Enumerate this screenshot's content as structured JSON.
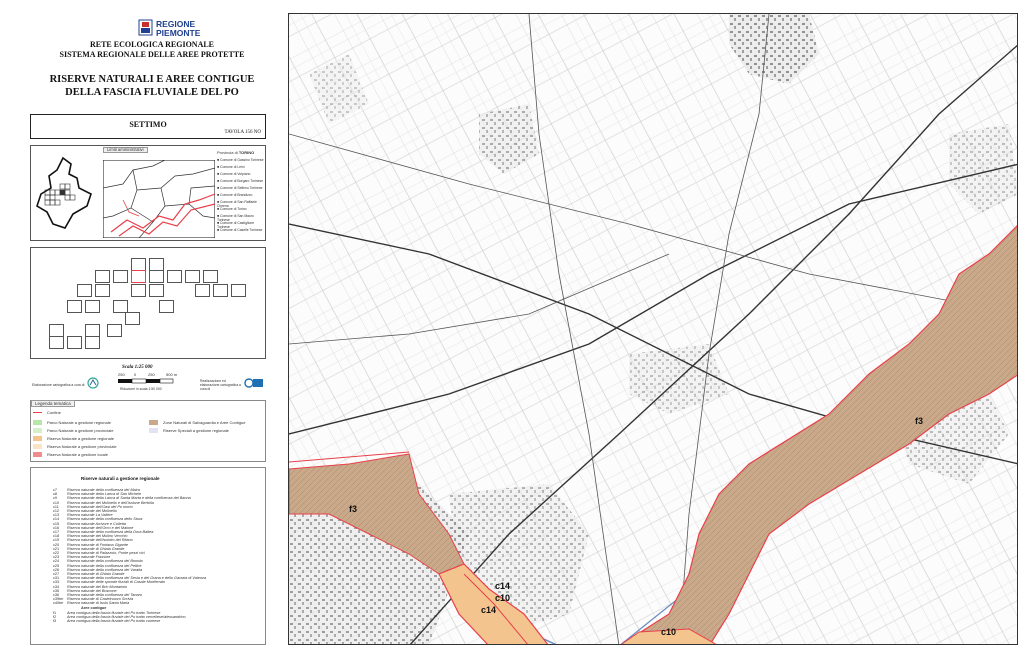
{
  "header": {
    "logo_line1": "REGIONE",
    "logo_line2": "PIEMONTE",
    "network_line1": "RETE ECOLOGICA REGIONALE",
    "network_line2": "SISTEMA REGIONALE DELLE AREE PROTETTE",
    "title_line1": "RISERVE NATURALI E AREE CONTIGUE",
    "title_line2": "DELLA FASCIA FLUVIALE DEL PO"
  },
  "sheet": {
    "name": "SETTIMO",
    "tavola": "TAVOLA 156 NO"
  },
  "admin": {
    "title": "Limiti amministrativi",
    "province_label": "Provincia di",
    "province_name": "TORINO",
    "communes": [
      "Comune di Gassino Torinese",
      "Comune di Leini",
      "Comune di Volpiano",
      "Comune di Borgaro Torinese",
      "Comune di Settimo Torinese",
      "Comune di Brandizzo",
      "Comune di San Raffaele Cimena",
      "Comune di Torino",
      "Comune di San Mauro Torinese",
      "Comune di Castiglione Torinese",
      "Comune di Caselle Torinese"
    ]
  },
  "scale": {
    "title": "Scala 1:25 000",
    "ticks": [
      "250",
      "0",
      "250",
      "500 m"
    ],
    "credit_left": "Elaborazione cartografica a cura di",
    "note": "Riduzione in scala 1:50 000",
    "credit_right": "Realizzazione ed elaborazione cartografica a cura di"
  },
  "legend": {
    "title": "Legenda tematica",
    "items": [
      {
        "label": "Confine",
        "color": "#e8404a"
      },
      {
        "label": "Parco Naturale a gestione regionale",
        "color": "#b7e6a9"
      },
      {
        "label": "Parco Naturale a gestione provinciale",
        "color": "#d5efc9"
      },
      {
        "label": "Riserva Naturale a gestione regionale",
        "color": "#f4c48f"
      },
      {
        "label": "Riserva Naturale a gestione provinciale",
        "color": "#fae4c6"
      },
      {
        "label": "Riserva Naturale a gestione locale",
        "color": "#ef8d8d"
      },
      {
        "label": "Zone Naturali di Salvaguardia e Aree Contigue",
        "color": "#c9a98a"
      },
      {
        "label": "Riserve Speciali a gestione regionale",
        "color": "#e3e3f4"
      }
    ]
  },
  "reserves": {
    "title": "Riserve naturali a gestione regionale",
    "items": [
      {
        "code": "c7",
        "name": "Riserva naturale della confluenza del Maira"
      },
      {
        "code": "c8",
        "name": "Riserva naturale della Lanca di San Michele"
      },
      {
        "code": "c9",
        "name": "Riserva naturale della Lanca di Santa Marta e della confluenza del Banna"
      },
      {
        "code": "c10",
        "name": "Riserva naturale del Molinello e dell'Isolone Bertolla"
      },
      {
        "code": "c11",
        "name": "Riserva naturale dell'Oasi del Po morto"
      },
      {
        "code": "c12",
        "name": "Riserva naturale del Molinello"
      },
      {
        "code": "c13",
        "name": "Riserva naturale La Vallere"
      },
      {
        "code": "c14",
        "name": "Riserva naturale della confluenza dello Stura"
      },
      {
        "code": "c15",
        "name": "Riserva naturale Arrivore e Colletta"
      },
      {
        "code": "c16",
        "name": "Riserva naturale dell'Orco e del Malone"
      },
      {
        "code": "c17",
        "name": "Riserva naturale della confluenza della Dora Baltea"
      },
      {
        "code": "c18",
        "name": "Riserva naturale del Mulino Vecchio"
      },
      {
        "code": "c19",
        "name": "Riserva naturale dell'Isolotto del Ritano"
      },
      {
        "code": "c20",
        "name": "Riserva naturale di Fontana Gigante"
      },
      {
        "code": "c21",
        "name": "Riserva naturale di Ghiaia Grande"
      },
      {
        "code": "c22",
        "name": "Riserva naturale di Palazzolo, Ponte pezzi vivi"
      },
      {
        "code": "c23",
        "name": "Riserva naturale Frassine"
      },
      {
        "code": "c24",
        "name": "Riserva naturale della confluenza del Bronda"
      },
      {
        "code": "c25",
        "name": "Riserva naturale della confluenza del Pellice"
      },
      {
        "code": "c26",
        "name": "Riserva naturale della confluenza del Varaita"
      },
      {
        "code": "c27",
        "name": "Riserva naturale di Ghiaia Grande"
      },
      {
        "code": "c31",
        "name": "Riserva naturale della confluenza del Sesia e del Grana e dello Garzaia di Valenza"
      },
      {
        "code": "c33",
        "name": "Riserva naturale delle sponde fluviali di Casale Monferrato"
      },
      {
        "code": "c34",
        "name": "Riserva naturale del Bric Montariolo"
      },
      {
        "code": "c35",
        "name": "Riserva naturale del Boscone"
      },
      {
        "code": "c36",
        "name": "Riserva naturale della confluenza del Tanaro"
      },
      {
        "code": "c39ter",
        "name": "Riserva naturale di Castelnuovo Scrivia"
      },
      {
        "code": "c40ter",
        "name": "Riserva naturale di Isola Santa Maria"
      }
    ],
    "contigue_title": "Aree contigue",
    "contigue": [
      {
        "code": "f1",
        "name": "Area contigua della fascia fluviale del Po tratto Torinese"
      },
      {
        "code": "f2",
        "name": "Area contigua della fascia fluviale del Po tratto vercellese/alessandrino"
      },
      {
        "code": "f3",
        "name": "Area contigua della fascia fluviale del Po tratto cuneese"
      }
    ]
  },
  "map": {
    "labels": [
      "f3",
      "f3",
      "c14",
      "c10",
      "c14",
      "c10"
    ],
    "reserve_fill": "#c9a98a",
    "boundary_color": "#e8404a"
  }
}
